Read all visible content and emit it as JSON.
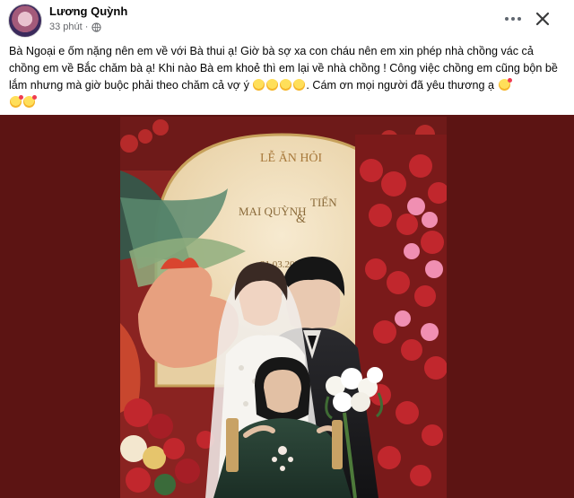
{
  "post": {
    "author": "Lương Quỳnh",
    "time": "33 phút ·",
    "caption_text": "Bà Ngoại e ốm nặng nên em về với Bà thui ạ! Giờ bà sợ xa con cháu nên em xin phép nhà chồng vác cả chồng em về Bắc chăm bà ạ! Khi nào Bà em khoẻ thì em lại về nhà chồng ! Công việc chồng em cũng bộn bề lắm nhưng mà giờ buộc phải theo chăm cả vợ ý",
    "caption_tail": ". Cám ơn mọi người đã yêu thương ạ",
    "privacy_icon": "globe-icon"
  },
  "photo": {
    "sign_title": "LỄ ĂN HỎI",
    "sign_name_left": "MAI QUỲNH",
    "sign_ampersand": "&",
    "sign_name_right": "TIẾN",
    "sign_date": "31.03.2021"
  },
  "colors": {
    "backdrop": "#5c1413",
    "accent": "#1877f2",
    "muted": "#65676b"
  }
}
